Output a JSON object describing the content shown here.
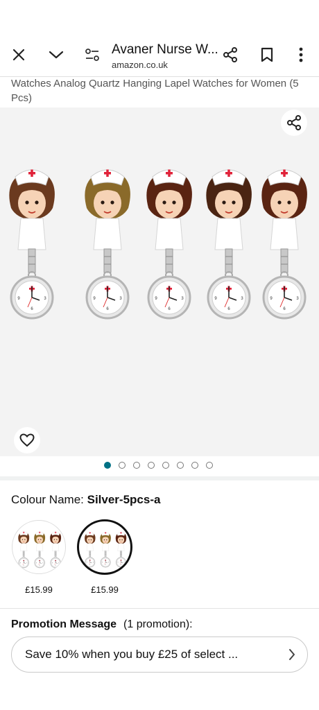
{
  "toolbar": {
    "title": "Avaner Nurse W...",
    "domain": "amazon.co.uk",
    "icons": [
      "close-icon",
      "chevron-down-icon",
      "page-settings-icon",
      "share-icon",
      "bookmark-icon",
      "more-vertical-icon"
    ]
  },
  "product": {
    "title_tail": "Watches Analog Quartz Hanging Lapel Watches for Women (5 Pcs)"
  },
  "gallery": {
    "image_count": 8,
    "active_index": 0,
    "watches": [
      {
        "hair": "#6b3a1f",
        "cap_cross": "#e0233a"
      },
      {
        "hair": "#8a6a2a",
        "cap_cross": "#e0233a"
      },
      {
        "hair": "#5a2412",
        "cap_cross": "#e0233a"
      },
      {
        "hair": "#4a2412",
        "cap_cross": "#e0233a"
      },
      {
        "hair": "#5a2412",
        "cap_cross": "#e0233a"
      }
    ]
  },
  "colour": {
    "label": "Colour Name:",
    "value": "Silver-5pcs-a",
    "options": [
      {
        "price": "£15.99",
        "selected": false
      },
      {
        "price": "£15.99",
        "selected": true
      }
    ]
  },
  "promotion": {
    "heading": "Promotion Message",
    "count": "(1 promotion):",
    "text": "Save 10% when you buy £25 of select ..."
  },
  "colors": {
    "accent": "#007185",
    "text": "#111111",
    "muted": "#555555",
    "gallery_bg": "#f3f3f3"
  }
}
